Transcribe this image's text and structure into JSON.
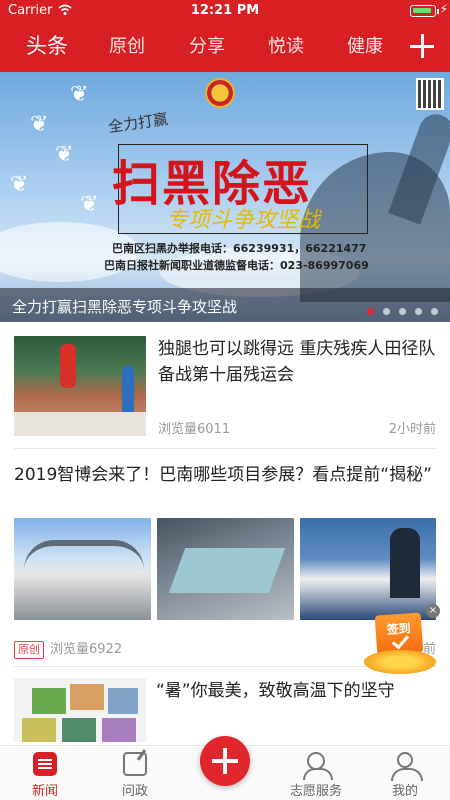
{
  "status_bar": {
    "carrier": "Carrier",
    "time": "12:21 PM"
  },
  "nav_tabs": [
    "头条",
    "原创",
    "分享",
    "悦读",
    "健康"
  ],
  "banner": {
    "slogan": "全力打赢",
    "headline": "扫黑除恶",
    "subline": "专项斗争攻坚战",
    "contact_1": "巴南区扫黑办举报电话：66239931，66221477",
    "contact_2": "巴南日报社新闻职业道德监督电话：023-86997069",
    "caption": "全力打赢扫黑除恶专项斗争攻坚战",
    "active_slide": 1,
    "slide_count": 5
  },
  "feed": {
    "items": [
      {
        "title": "独腿也可以跳得远 重庆残疾人田径队备战第十届残运会",
        "views": "浏览量6011",
        "time": "2小时前"
      },
      {
        "title": "2019智博会来了！巴南哪些项目参展？看点提前“揭秘”",
        "tag": "原创",
        "views": "浏览量6922",
        "time": "前"
      },
      {
        "title": "“暑”你最美，致敬高温下的坚守"
      }
    ]
  },
  "signin": {
    "label": "签到",
    "close": "×"
  },
  "tabbar": {
    "news": "新闻",
    "ask": "问政",
    "volunteer": "志愿服务",
    "me": "我的"
  },
  "colors": {
    "brand": "#d71f24",
    "tag": "#e0464a"
  }
}
